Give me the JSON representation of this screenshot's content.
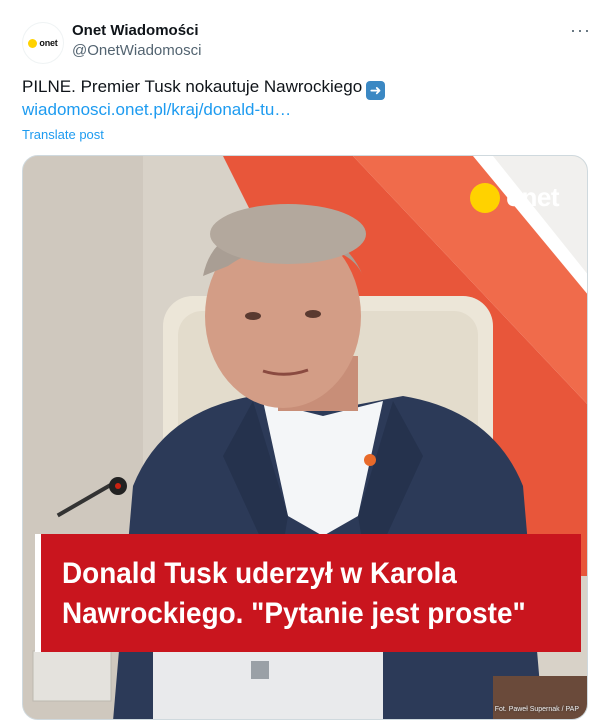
{
  "account": {
    "avatar_text": "onet",
    "display_name": "Onet Wiadomości",
    "handle": "@OnetWiadomosci",
    "more_icon": "ellipsis-icon"
  },
  "post": {
    "text": "PILNE. Premier Tusk nokautuje Nawrockiego",
    "emoji": "➡️",
    "link": "wiadomosci.onet.pl/kraj/donald-tu…",
    "translate_label": "Translate post"
  },
  "media": {
    "brand": "onet",
    "headline_line1": "Donald Tusk uderzył w Karola",
    "headline_line2": "Nawrockiego. \"Pytanie jest proste\"",
    "credit": "Fot. Paweł Supernak / PAP",
    "colors": {
      "headline_bg": "#c9151e",
      "brand_yellow": "#ffd200",
      "link_blue": "#1d9bf0"
    }
  }
}
